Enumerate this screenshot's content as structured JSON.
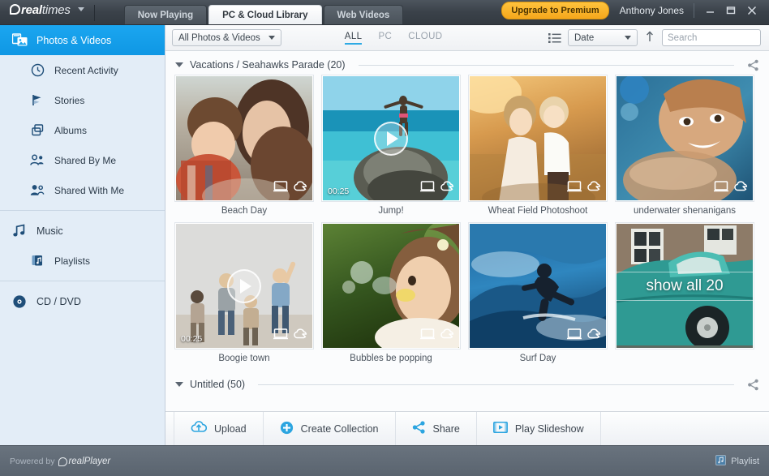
{
  "titlebar": {
    "brand_main": "real",
    "brand_sub": "times",
    "tabs": [
      {
        "label": "Now Playing",
        "active": false
      },
      {
        "label": "PC & Cloud Library",
        "active": true
      },
      {
        "label": "Web Videos",
        "active": false
      }
    ],
    "upgrade_label": "Upgrade to Premium",
    "user_name": "Anthony Jones",
    "minimize": "minimize-icon",
    "maximize": "maximize-icon",
    "close": "close-icon"
  },
  "sidebar": {
    "items": [
      {
        "label": "Photos & Videos",
        "icon": "photos-videos-icon",
        "active": true,
        "sub": false
      },
      {
        "label": "Recent Activity",
        "icon": "clock-icon",
        "active": false,
        "sub": true
      },
      {
        "label": "Stories",
        "icon": "stories-icon",
        "active": false,
        "sub": true
      },
      {
        "label": "Albums",
        "icon": "albums-icon",
        "active": false,
        "sub": true
      },
      {
        "label": "Shared By Me",
        "icon": "shared-by-me-icon",
        "active": false,
        "sub": true
      },
      {
        "label": "Shared With Me",
        "icon": "shared-with-me-icon",
        "active": false,
        "sub": true
      }
    ],
    "items2": [
      {
        "label": "Music",
        "icon": "music-note-icon",
        "active": false,
        "sub": false
      },
      {
        "label": "Playlists",
        "icon": "playlist-icon",
        "active": false,
        "sub": true
      }
    ],
    "items3": [
      {
        "label": "CD / DVD",
        "icon": "disc-icon",
        "active": false,
        "sub": false
      }
    ]
  },
  "toolbar": {
    "source_select": "All Photos & Videos",
    "filters": [
      {
        "label": "ALL",
        "active": true
      },
      {
        "label": "PC",
        "active": false
      },
      {
        "label": "CLOUD",
        "active": false
      }
    ],
    "view_icon": "list-view-icon",
    "sort_select": "Date",
    "sort_direction_icon": "sort-ascending-icon",
    "search_placeholder": "Search",
    "search_value": "",
    "search_icon": "search-icon"
  },
  "sections": [
    {
      "title": "Vacations / Seahawks Parade (20)",
      "share_icon": "share-icon",
      "items": [
        {
          "caption": "Beach Day",
          "type": "photo",
          "duration": "",
          "on_pc": true,
          "on_cloud": true
        },
        {
          "caption": "Jump!",
          "type": "video",
          "duration": "00:25",
          "on_pc": true,
          "on_cloud": true
        },
        {
          "caption": "Wheat Field Photoshoot",
          "type": "photo",
          "duration": "",
          "on_pc": true,
          "on_cloud": true
        },
        {
          "caption": "underwater shenanigans",
          "type": "photo",
          "duration": "",
          "on_pc": true,
          "on_cloud": true
        },
        {
          "caption": "Boogie town",
          "type": "video",
          "duration": "00:25",
          "on_pc": true,
          "on_cloud": true
        },
        {
          "caption": "Bubbles be popping",
          "type": "photo",
          "duration": "",
          "on_pc": true,
          "on_cloud": true
        },
        {
          "caption": "Surf Day",
          "type": "photo",
          "duration": "",
          "on_pc": true,
          "on_cloud": true
        },
        {
          "caption": "",
          "type": "more",
          "duration": "",
          "overlay": "show all 20",
          "on_pc": false,
          "on_cloud": false
        }
      ]
    },
    {
      "title": "Untitled (50)",
      "share_icon": "share-icon",
      "items": []
    }
  ],
  "actionbar": {
    "actions": [
      {
        "label": "Upload",
        "icon": "upload-cloud-icon"
      },
      {
        "label": "Create Collection",
        "icon": "plus-circle-icon"
      },
      {
        "label": "Share",
        "icon": "share-icon"
      },
      {
        "label": "Play Slideshow",
        "icon": "slideshow-icon"
      }
    ]
  },
  "statusbar": {
    "powered_prefix": "Powered by",
    "powered_brand": "real",
    "powered_brand_sub": "Player",
    "playlist_label": "Playlist",
    "playlist_icon": "playlist-panel-icon"
  },
  "colors": {
    "accent_blue": "#0f97e4",
    "upgrade_orange": "#f5a71c",
    "sidebar_bg": "#e3edf7",
    "titlebar_dark": "#3b424a"
  }
}
